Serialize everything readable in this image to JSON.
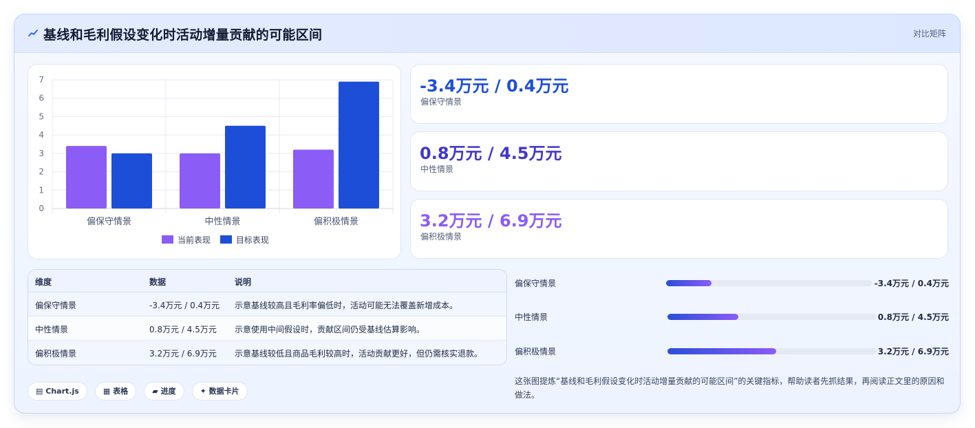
{
  "header": {
    "title": "基线和毛利假设变化时活动增量贡献的可能区间",
    "tag": "对比矩阵"
  },
  "chart_data": {
    "type": "bar",
    "categories": [
      "偏保守情景",
      "中性情景",
      "偏积极情景"
    ],
    "series": [
      {
        "name": "当前表现",
        "values": [
          3.4,
          3.0,
          3.2
        ],
        "color": "#8b5cf6"
      },
      {
        "name": "目标表现",
        "values": [
          3.0,
          4.5,
          6.9
        ],
        "color": "#1d4ed8"
      }
    ],
    "ylim": [
      0,
      7
    ],
    "yticks": [
      0,
      1,
      2,
      3,
      4,
      5,
      6,
      7
    ],
    "grid": true,
    "legend": "bottom"
  },
  "stats": [
    {
      "value": "-3.4万元 / 0.4万元",
      "label": "偏保守情景",
      "color": "#1d4ed8"
    },
    {
      "value": "0.8万元 / 4.5万元",
      "label": "中性情景",
      "color": "#4338ca"
    },
    {
      "value": "3.2万元 / 6.9万元",
      "label": "偏积极情景",
      "color": "#8b5cf6"
    }
  ],
  "table": {
    "headers": [
      "维度",
      "数据",
      "说明"
    ],
    "rows": [
      [
        "偏保守情景",
        "-3.4万元 / 0.4万元",
        "示意基线较高且毛利率偏低时，活动可能无法覆盖新增成本。"
      ],
      [
        "中性情景",
        "0.8万元 / 4.5万元",
        "示意使用中间假设时，贡献区间仍受基线估算影响。"
      ],
      [
        "偏积极情景",
        "3.2万元 / 6.9万元",
        "示意基线较低且商品毛利较高时，活动贡献更好，但仍需核实退款。"
      ]
    ]
  },
  "progress": [
    {
      "label": "偏保守情景",
      "value": "-3.4万元 / 0.4万元",
      "fraction": 0.22
    },
    {
      "label": "中性情景",
      "value": "0.8万元 / 4.5万元",
      "fraction": 0.34
    },
    {
      "label": "偏积极情景",
      "value": "3.2万元 / 6.9万元",
      "fraction": 0.52
    }
  ],
  "chips": [
    {
      "icon": "▤",
      "label": "Chart.js"
    },
    {
      "icon": "▦",
      "label": "表格"
    },
    {
      "icon": "▰",
      "label": "进度"
    },
    {
      "icon": "✦",
      "label": "数据卡片"
    }
  ],
  "note": "这张图提炼“基线和毛利假设变化时活动增量贡献的可能区间”的关键指标，帮助读者先抓结果，再阅读正文里的原因和做法。"
}
